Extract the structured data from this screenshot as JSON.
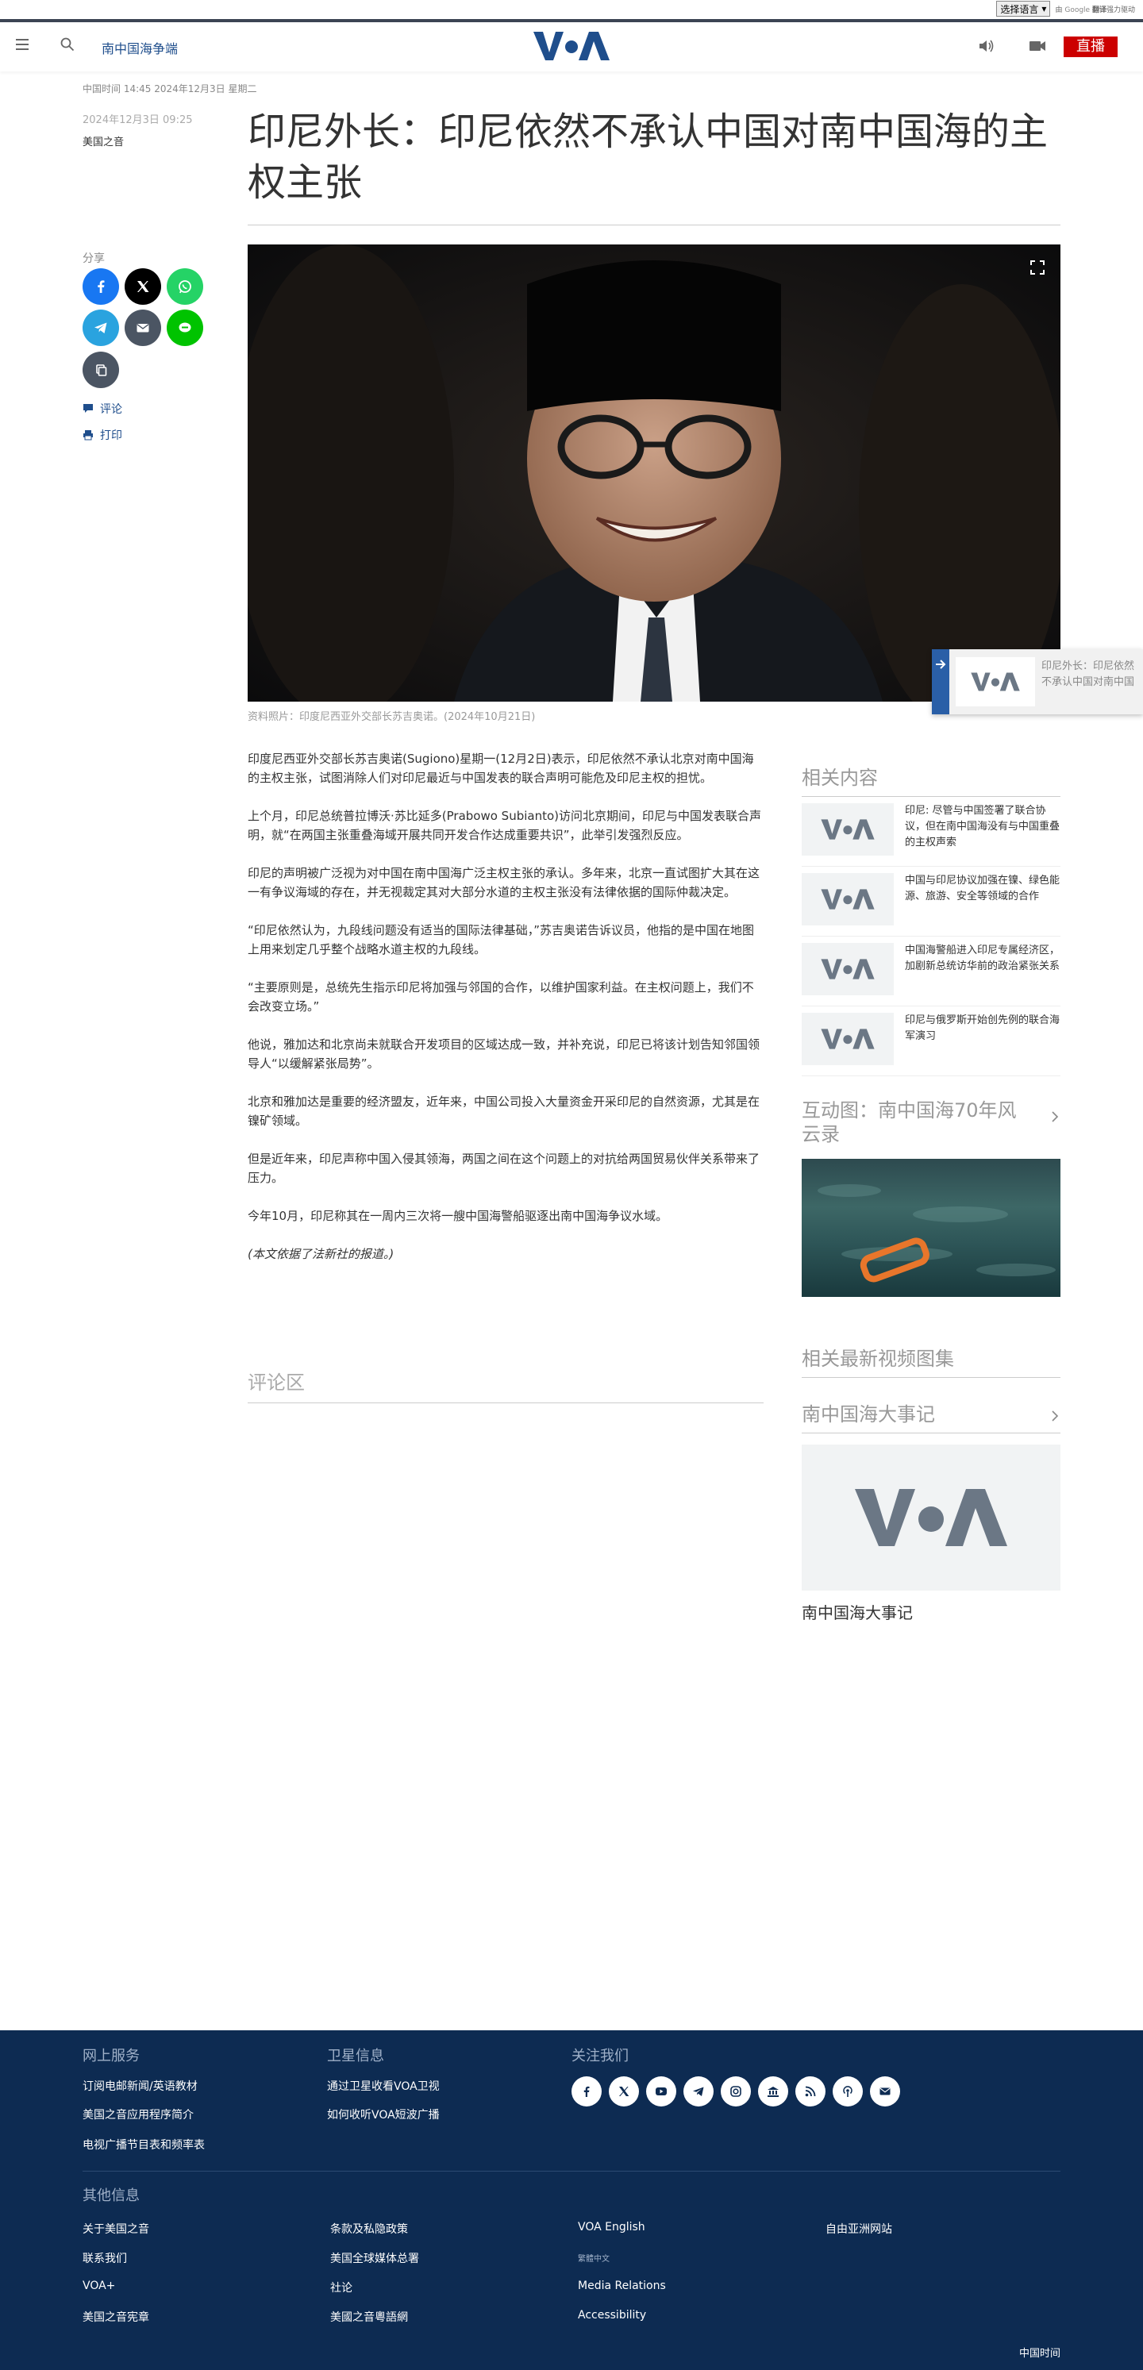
{
  "translate_bar": {
    "select_label": "选择语言",
    "powered_by": "由",
    "google": "Google",
    "translate": "翻译",
    "suffix": "强力驱动"
  },
  "header": {
    "section": "南中国海争端",
    "live_label": "直播"
  },
  "datebar": "中国时间 14:45 2024年12月3日 星期二",
  "article": {
    "published": "2024年12月3日 09:25",
    "author": "美国之音",
    "title": "印尼外长：印尼依然不承认中国对南中国海的主权主张",
    "caption": "资料照片：印度尼西亚外交部长苏吉奥诺。(2024年10月21日)",
    "paragraphs": [
      "印度尼西亚外交部长苏吉奥诺(Sugiono)星期一(12月2日)表示，印尼依然不承认北京对南中国海的主权主张，试图消除人们对印尼最近与中国发表的联合声明可能危及印尼主权的担忧。",
      "上个月，印尼总统普拉博沃·苏比延多(Prabowo Subianto)访问北京期间，印尼与中国发表联合声明，就“在两国主张重叠海域开展共同开发合作达成重要共识”，此举引发强烈反应。",
      "印尼的声明被广泛视为对中国在南中国海广泛主权主张的承认。多年来，北京一直试图扩大其在这一有争议海域的存在，并无视裁定其对大部分水道的主权主张没有法律依据的国际仲裁决定。",
      "“印尼依然认为，九段线问题没有适当的国际法律基础，”苏吉奥诺告诉议员，他指的是中国在地图上用来划定几乎整个战略水道主权的九段线。",
      "“主要原则是，总统先生指示印尼将加强与邻国的合作，以维护国家利益。在主权问题上，我们不会改变立场。”",
      "他说，雅加达和北京尚未就联合开发项目的区域达成一致，并补充说，印尼已将该计划告知邻国领导人“以缓解紧张局势”。",
      "北京和雅加达是重要的经济盟友，近年来，中国公司投入大量资金开采印尼的自然资源，尤其是在镍矿领域。",
      "但是近年来，印尼声称中国入侵其领海，两国之间在这个问题上的对抗给两国贸易伙伴关系带来了压力。",
      "今年10月，印尼称其在一周内三次将一艘中国海警船驱逐出南中国海争议水域。"
    ],
    "credit": "(本文依据了法新社的报道。)"
  },
  "share": {
    "label": "分享",
    "comment": "评论",
    "print": "打印"
  },
  "mini_player": {
    "text": "印尼外长：印尼依然不承认中国对南中国海的主权主张"
  },
  "comments_heading": "评论区",
  "sidebar": {
    "related_heading": "相关内容",
    "related": [
      "印尼: 尽管与中国签署了联合协议，但在南中国海没有与中国重叠的主权声索",
      "中国与印尼协议加强在镍、绿色能源、旅游、安全等领域的合作",
      "中国海警船进入印尼专属经济区，加剧新总统访华前的政治紧张关系",
      "印尼与俄罗斯开始创先例的联合海军演习"
    ],
    "interactive_heading": "互动图：南中国海70年风云录",
    "videos_heading": "相关最新视频图集",
    "timeline_heading": "南中国海大事记",
    "timeline_caption": "南中国海大事记"
  },
  "footer": {
    "col1_heading": "网上服务",
    "col1": [
      "订阅电邮新闻/英语教材",
      "美国之音应用程序简介",
      "电视广播节目表和频率表"
    ],
    "col2_heading": "卫星信息",
    "col2": [
      "通过卫星收看VOA卫视",
      "如何收听VOA短波广播"
    ],
    "col3_heading": "关注我们",
    "social_icons": [
      "facebook-icon",
      "x-icon",
      "youtube-icon",
      "telegram-icon",
      "instagram-icon",
      "podcast-building-icon",
      "rss-icon",
      "podcast-icon",
      "email-icon"
    ],
    "other_heading": "其他信息",
    "other_cols": [
      [
        "关于美国之音",
        "联系我们",
        "VOA+",
        "美国之音宪章"
      ],
      [
        "条款及私隐政策",
        "美国全球媒体总署",
        "社论",
        "美國之音粵語網"
      ],
      [
        "VOA English",
        "繁體中文",
        "Media Relations",
        "Accessibility"
      ],
      [
        "自由亚洲网站"
      ]
    ],
    "time_label": "中国时间"
  },
  "colors": {
    "brand_blue": "#1f4e8c",
    "live_red": "#cc0000",
    "footer_bg": "#0d2b52"
  }
}
